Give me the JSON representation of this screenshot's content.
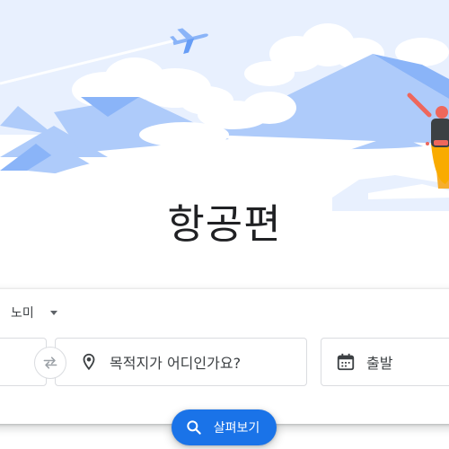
{
  "hero": {
    "title": "항공편",
    "illustration": "travel-scene",
    "colors": {
      "sky": "#e8f0fe",
      "mountain": "#aecbfa",
      "mountain_dark": "#8ab4f8",
      "cloud": "#ffffff",
      "traveler_shirt": "#f6ae2d",
      "traveler_skin": "#ee675c",
      "backpack": "#3c4043"
    }
  },
  "search": {
    "cabin_class": "노미",
    "origin": "",
    "destination_placeholder": "목적지가 어디인가요?",
    "departure_label": "출발"
  },
  "actions": {
    "explore_label": "살펴보기"
  },
  "icons": {
    "swap": "swap-icon",
    "destination": "location-pin-icon",
    "date": "calendar-icon",
    "explore": "search-icon"
  },
  "colors": {
    "accent": "#1a73e8",
    "border": "#dadce0",
    "text": "#202124",
    "icon": "#5f6368"
  }
}
